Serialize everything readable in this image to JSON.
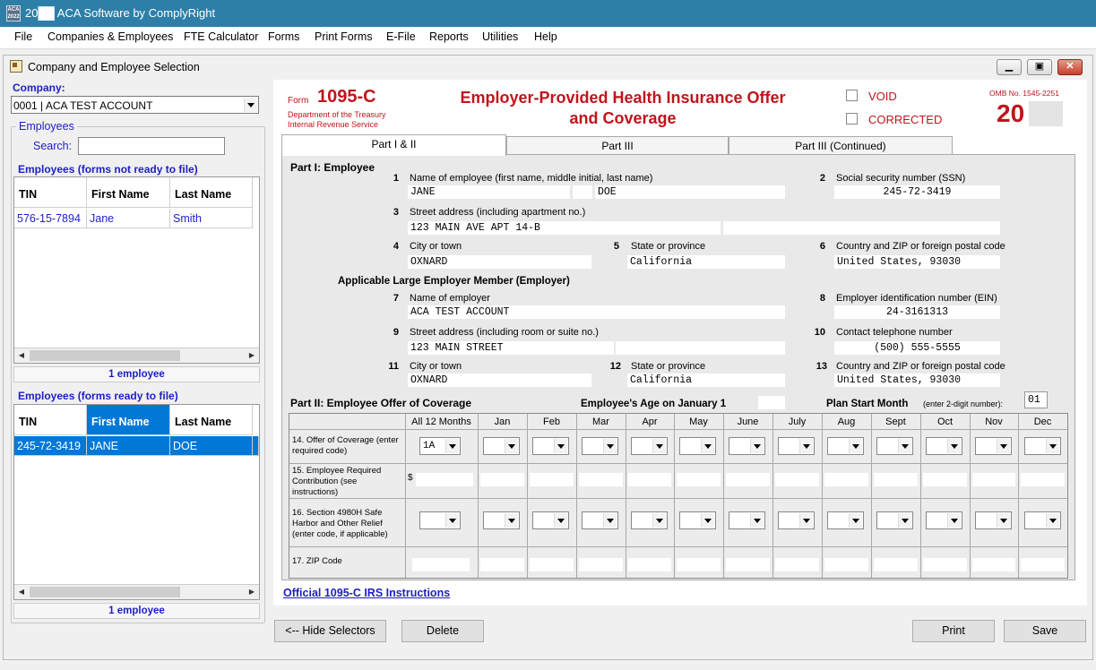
{
  "app": {
    "title": "20██ ACA Software by ComplyRight",
    "icon_text": "ACA 2022"
  },
  "menu": [
    "File",
    "Companies & Employees",
    "FTE Calculator",
    "Forms",
    "Print Forms",
    "E-File",
    "Reports",
    "Utilities",
    "Help"
  ],
  "window": {
    "title": "Company and Employee Selection"
  },
  "selector": {
    "company_label": "Company:",
    "company_value": "0001 | ACA TEST ACCOUNT",
    "employees_group": "Employees",
    "search_label": "Search:",
    "search_value": "",
    "not_ready_label": "Employees (forms not ready to file)",
    "ready_label": "Employees (forms ready to file)",
    "columns": [
      "TIN",
      "First Name",
      "Last Name"
    ],
    "not_ready_rows": [
      {
        "tin": "576-15-7894",
        "first": "Jane",
        "last": "Smith"
      }
    ],
    "ready_rows": [
      {
        "tin": "245-72-3419",
        "first": "JANE",
        "last": "DOE"
      }
    ],
    "not_ready_count": "1 employee",
    "ready_count": "1 employee"
  },
  "form": {
    "form_word": "Form",
    "form_number": "1095-C",
    "dept1": "Department of the Treasury",
    "dept2": "Internal Revenue Service",
    "title_line1": "Employer-Provided Health Insurance Offer",
    "title_line2": "and Coverage",
    "void_label": "VOID",
    "corrected_label": "CORRECTED",
    "omb": "OMB No. 1545-2251",
    "year": "20",
    "tabs": [
      "Part I & II",
      "Part III",
      "Part III (Continued)"
    ],
    "part1_title": "Part I:  Employee",
    "f1_label": "Name of employee (first name, middle initial, last name)",
    "f1_first": "JANE",
    "f1_middle": "",
    "f1_last": "DOE",
    "f2_label": "Social security number (SSN)",
    "f2_value": "245-72-3419",
    "f3_label": "Street address (including apartment no.)",
    "f3_value": "123 MAIN AVE APT 14-B",
    "f3_value2": "",
    "f4_label": "City or town",
    "f4_value": "OXNARD",
    "f5_label": "State or province",
    "f5_value": "California",
    "f6_label": "Country and ZIP or foreign postal code",
    "f6_value": "United States, 93030",
    "employer_title": "Applicable Large Employer Member (Employer)",
    "f7_label": "Name of employer",
    "f7_value": "ACA TEST ACCOUNT",
    "f8_label": "Employer identification number (EIN)",
    "f8_value": "24-3161313",
    "f9_label": "Street address (including room or suite no.)",
    "f9_value": "123 MAIN STREET",
    "f9_value2": "",
    "f10_label": "Contact telephone number",
    "f10_value": "(500) 555-5555",
    "f11_label": "City or town",
    "f11_value": "OXNARD",
    "f12_label": "State or province",
    "f12_value": "California",
    "f13_label": "Country and ZIP or foreign postal code",
    "f13_value": "United States, 93030",
    "part2_title": "Part II:  Employee Offer of Coverage",
    "age_label": "Employee's Age on January 1",
    "age_value": "",
    "plan_start_label": "Plan Start Month",
    "plan_start_hint": "(enter 2-digit number):",
    "plan_start_value": "01",
    "months": [
      "All 12 Months",
      "Jan",
      "Feb",
      "Mar",
      "Apr",
      "May",
      "June",
      "July",
      "Aug",
      "Sept",
      "Oct",
      "Nov",
      "Dec"
    ],
    "row14": "14.  Offer of Coverage (enter required code)",
    "row14_all": "1A",
    "row15": "15.  Employee Required Contribution (see instructions)",
    "dollar": "$",
    "row16": "16.  Section 4980H Safe Harbor and Other Relief (enter code, if applicable)",
    "row17": "17.  ZIP Code",
    "instructions_link": "Official 1095-C IRS Instructions"
  },
  "buttons": {
    "hide": "<-- Hide Selectors",
    "delete": "Delete",
    "print": "Print",
    "save": "Save"
  },
  "colors": {
    "titlebar": "#2d7fa7",
    "accent_blue": "#1e1ec8",
    "form_red": "#c0141c",
    "selection": "#0078d7"
  }
}
